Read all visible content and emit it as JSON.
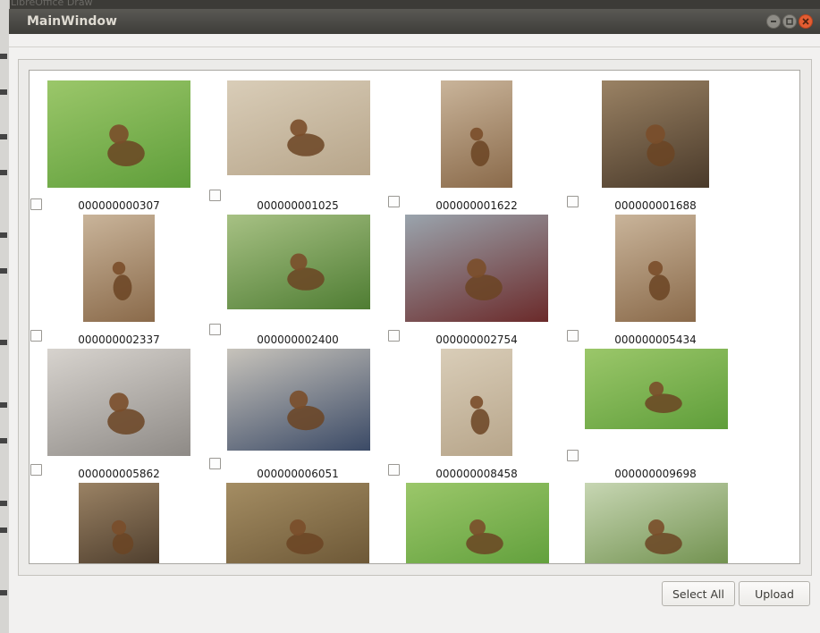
{
  "background_app": {
    "title": "LibreOffice Draw"
  },
  "window": {
    "title": "MainWindow"
  },
  "items": [
    {
      "caption": "000000000307",
      "scene": "grass"
    },
    {
      "caption": "000000001025",
      "scene": "sand"
    },
    {
      "caption": "000000001622",
      "scene": "indoor"
    },
    {
      "caption": "000000001688",
      "scene": "indoor-dark"
    },
    {
      "caption": "000000002337",
      "scene": "indoor"
    },
    {
      "caption": "000000002400",
      "scene": "park"
    },
    {
      "caption": "000000002754",
      "scene": "car"
    },
    {
      "caption": "000000005434",
      "scene": "indoor"
    },
    {
      "caption": "000000005862",
      "scene": "bedroom"
    },
    {
      "caption": "000000006051",
      "scene": "bus"
    },
    {
      "caption": "000000008458",
      "scene": "sand"
    },
    {
      "caption": "000000009698",
      "scene": "grass"
    },
    {
      "caption": "",
      "scene": "indoor-dark"
    },
    {
      "caption": "",
      "scene": "leaves"
    },
    {
      "caption": "",
      "scene": "grass"
    },
    {
      "caption": "",
      "scene": "farm"
    }
  ],
  "buttons": {
    "select_all": "Select All",
    "upload": "Upload"
  },
  "colors": {
    "titlebar": "#3e3d39",
    "close_button": "#e35d32",
    "window_bg": "#f2f1f0"
  }
}
